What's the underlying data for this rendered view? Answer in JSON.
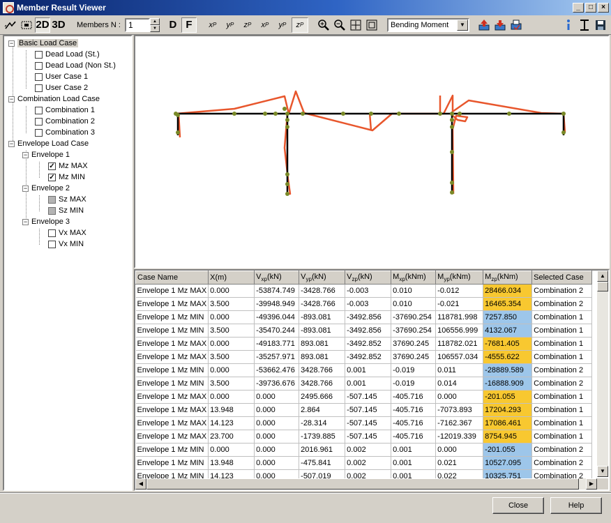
{
  "window": {
    "title": "Member Result Viewer"
  },
  "toolbar": {
    "view_2d": "2D",
    "view_3d": "3D",
    "members_label": "Members N :",
    "members_value": "1",
    "btn_d": "D",
    "btn_f": "F",
    "force_buttons": [
      {
        "name": "xp-force-button",
        "base": "x",
        "sub": "P"
      },
      {
        "name": "yp-force-button",
        "base": "y",
        "sub": "P"
      },
      {
        "name": "zp-force-button",
        "base": "z",
        "sub": "P"
      },
      {
        "name": "xp-moment-button",
        "base": "x",
        "sub": "P"
      },
      {
        "name": "yp-moment-button",
        "base": "y",
        "sub": "P"
      },
      {
        "name": "zp-moment-button",
        "base": "z",
        "sub": "P"
      }
    ],
    "result_type": "Bending Moment"
  },
  "tree": [
    {
      "label": "Basic Load Case",
      "level": 0,
      "expander": "-",
      "checkbox": null,
      "selected": true
    },
    {
      "label": "Dead Load (St.)",
      "level": 1,
      "checkbox": "unchecked"
    },
    {
      "label": "Dead Load (Non St.)",
      "level": 1,
      "checkbox": "unchecked"
    },
    {
      "label": "User Case 1",
      "level": 1,
      "checkbox": "unchecked"
    },
    {
      "label": "User Case 2",
      "level": 1,
      "checkbox": "unchecked"
    },
    {
      "label": "Combination Load Case",
      "level": 0,
      "expander": "-",
      "checkbox": null
    },
    {
      "label": "Combination 1",
      "level": 1,
      "checkbox": "unchecked"
    },
    {
      "label": "Combination 2",
      "level": 1,
      "checkbox": "unchecked"
    },
    {
      "label": "Combination 3",
      "level": 1,
      "checkbox": "unchecked"
    },
    {
      "label": "Envelope Load Case",
      "level": 0,
      "expander": "-",
      "checkbox": null
    },
    {
      "label": "Envelope 1",
      "level": 1,
      "expander": "-",
      "checkbox": null
    },
    {
      "label": "Mz MAX",
      "level": 2,
      "checkbox": "checked"
    },
    {
      "label": "Mz MIN",
      "level": 2,
      "checkbox": "checked"
    },
    {
      "label": "Envelope 2",
      "level": 1,
      "expander": "-",
      "checkbox": null
    },
    {
      "label": "Sz MAX",
      "level": 2,
      "checkbox": "grey"
    },
    {
      "label": "Sz MIN",
      "level": 2,
      "checkbox": "grey"
    },
    {
      "label": "Envelope 3",
      "level": 1,
      "expander": "-",
      "checkbox": null
    },
    {
      "label": "Vx MAX",
      "level": 2,
      "checkbox": "unchecked"
    },
    {
      "label": "Vx MIN",
      "level": 2,
      "checkbox": "unchecked"
    }
  ],
  "table": {
    "columns": [
      {
        "base": "Case Name",
        "sub": "",
        "unit": ""
      },
      {
        "base": "X(m)",
        "sub": "",
        "unit": ""
      },
      {
        "base": "V",
        "sub": "xp",
        "unit": "(kN)"
      },
      {
        "base": "V",
        "sub": "yp",
        "unit": "(kN)"
      },
      {
        "base": "V",
        "sub": "zp",
        "unit": "(kN)"
      },
      {
        "base": "M",
        "sub": "xp",
        "unit": "(kNm)"
      },
      {
        "base": "M",
        "sub": "yp",
        "unit": "(kNm)"
      },
      {
        "base": "M",
        "sub": "zp",
        "unit": "(kNm)"
      },
      {
        "base": "Selected Case",
        "sub": "",
        "unit": ""
      }
    ],
    "rows": [
      {
        "cells": [
          "Envelope 1 Mz MAX",
          "0.000",
          "-53874.749",
          "-3428.766",
          "-0.003",
          "0.010",
          "-0.012",
          "28466.034",
          "Combination 2"
        ],
        "kind": "max"
      },
      {
        "cells": [
          "Envelope 1 Mz MAX",
          "3.500",
          "-39948.949",
          "-3428.766",
          "-0.003",
          "0.010",
          "-0.021",
          "16465.354",
          "Combination 2"
        ],
        "kind": "max"
      },
      {
        "cells": [
          "Envelope 1 Mz MIN",
          "0.000",
          "-49396.044",
          "-893.081",
          "-3492.856",
          "-37690.254",
          "118781.998",
          "7257.850",
          "Combination 1"
        ],
        "kind": "min"
      },
      {
        "cells": [
          "Envelope 1 Mz MIN",
          "3.500",
          "-35470.244",
          "-893.081",
          "-3492.856",
          "-37690.254",
          "106556.999",
          "4132.067",
          "Combination 1"
        ],
        "kind": "min"
      },
      {
        "cells": [
          "Envelope 1 Mz MAX",
          "0.000",
          "-49183.771",
          "893.081",
          "-3492.852",
          "37690.245",
          "118782.021",
          "-7681.405",
          "Combination 1"
        ],
        "kind": "max"
      },
      {
        "cells": [
          "Envelope 1 Mz MAX",
          "3.500",
          "-35257.971",
          "893.081",
          "-3492.852",
          "37690.245",
          "106557.034",
          "-4555.622",
          "Combination 1"
        ],
        "kind": "max"
      },
      {
        "cells": [
          "Envelope 1 Mz MIN",
          "0.000",
          "-53662.476",
          "3428.766",
          "0.001",
          "-0.019",
          "0.011",
          "-28889.589",
          "Combination 2"
        ],
        "kind": "min"
      },
      {
        "cells": [
          "Envelope 1 Mz MIN",
          "3.500",
          "-39736.676",
          "3428.766",
          "0.001",
          "-0.019",
          "0.014",
          "-16888.909",
          "Combination 2"
        ],
        "kind": "min"
      },
      {
        "cells": [
          "Envelope 1 Mz MAX",
          "0.000",
          "0.000",
          "2495.666",
          "-507.145",
          "-405.716",
          "0.000",
          "-201.055",
          "Combination 1"
        ],
        "kind": "max"
      },
      {
        "cells": [
          "Envelope 1 Mz MAX",
          "13.948",
          "0.000",
          "2.864",
          "-507.145",
          "-405.716",
          "-7073.893",
          "17204.293",
          "Combination 1"
        ],
        "kind": "max"
      },
      {
        "cells": [
          "Envelope 1 Mz MAX",
          "14.123",
          "0.000",
          "-28.314",
          "-507.145",
          "-405.716",
          "-7162.367",
          "17086.461",
          "Combination 1"
        ],
        "kind": "max"
      },
      {
        "cells": [
          "Envelope 1 Mz MAX",
          "23.700",
          "0.000",
          "-1739.885",
          "-507.145",
          "-405.716",
          "-12019.339",
          "8754.945",
          "Combination 1"
        ],
        "kind": "max"
      },
      {
        "cells": [
          "Envelope 1 Mz MIN",
          "0.000",
          "0.000",
          "2016.961",
          "0.002",
          "0.001",
          "0.000",
          "-201.055",
          "Combination 2"
        ],
        "kind": "min"
      },
      {
        "cells": [
          "Envelope 1 Mz MIN",
          "13.948",
          "0.000",
          "-475.841",
          "0.002",
          "0.001",
          "0.021",
          "10527.095",
          "Combination 2"
        ],
        "kind": "min"
      },
      {
        "cells": [
          "Envelope 1 Mz MIN",
          "14.123",
          "0.000",
          "-507.019",
          "0.002",
          "0.001",
          "0.022",
          "10325.751",
          "Combination 2"
        ],
        "kind": "min"
      }
    ]
  },
  "buttons": {
    "close": "Close",
    "help": "Help"
  },
  "colors": {
    "diagram": "#e8562c",
    "structure": "#000000",
    "node": "#7a8a28",
    "max_highlight": "#f8c830",
    "min_highlight": "#9dc6ea"
  }
}
